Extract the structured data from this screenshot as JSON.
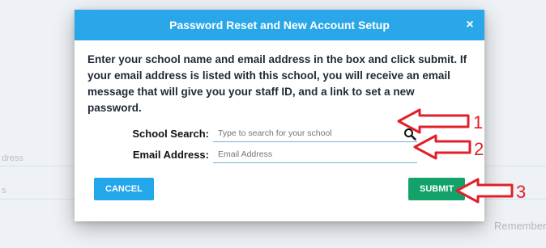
{
  "background": {
    "field_fragment_1": "dress",
    "field_fragment_2": "s",
    "remember_text": "Remember"
  },
  "modal": {
    "title": "Password Reset and New Account Setup",
    "close_symbol": "×",
    "instructions": "Enter your school name and email address in the box and click submit. If your email address is listed with this school, you will receive an email message that will give you your staff ID, and a link to set a new password.",
    "school_search": {
      "label": "School Search:",
      "placeholder": "Type to search for your school",
      "value": ""
    },
    "email": {
      "label": "Email Address:",
      "placeholder": "Email Address",
      "value": ""
    },
    "cancel_label": "CANCEL",
    "submit_label": "SUBMIT"
  },
  "annotations": [
    "1",
    "2",
    "3"
  ],
  "colors": {
    "header": "#2aa7e8",
    "cancel": "#22a7ea",
    "submit": "#13a36a",
    "annotation": "#e0202a"
  },
  "icons": {
    "search": "search-icon",
    "close": "close-icon"
  }
}
